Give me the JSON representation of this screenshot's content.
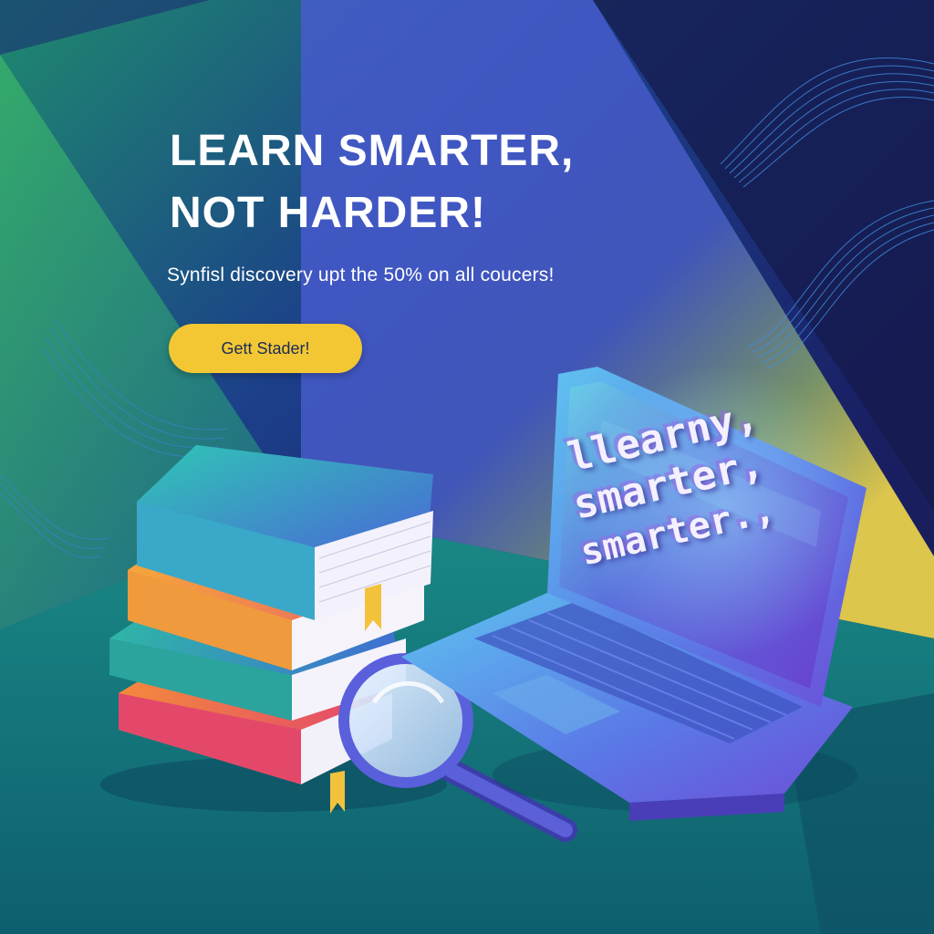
{
  "hero": {
    "headline_line1": "LEARN SMARTER,",
    "headline_line2": "NOT HARDER!",
    "subtitle": "Synfisl discovery upt the 50% on all coucers!",
    "cta_label": "Gett Stader!"
  },
  "laptop_screen": {
    "line1": "llearny,",
    "line2": "smarter,",
    "line3": "smarter.,"
  },
  "colors": {
    "cta_background": "#f2c733",
    "cta_text": "#1d2b57",
    "headline": "#ffffff",
    "desk": "#137a82",
    "background_deep": "#1a2266",
    "accent_yellow": "#f0d340"
  },
  "illustration": {
    "objects": [
      "book-stack-icon",
      "magnifying-glass-icon",
      "laptop-icon",
      "wave-lines"
    ]
  }
}
